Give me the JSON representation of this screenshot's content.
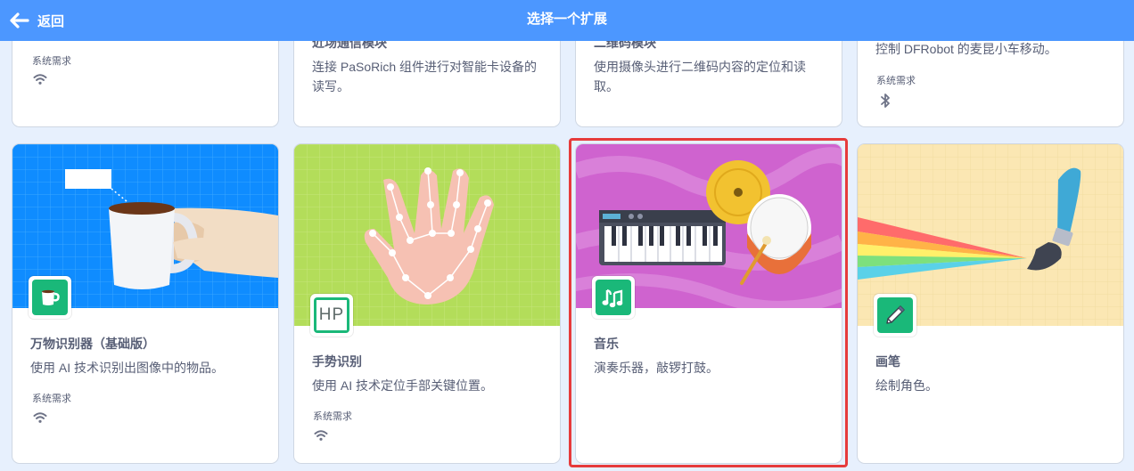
{
  "header": {
    "back_label": "返回",
    "title": "选择一个扩展"
  },
  "top_cards": [
    {
      "name": "",
      "description": "",
      "requirement_label": "系统需求",
      "requirement_icon": "wifi-icon"
    },
    {
      "name": "近场通信模块",
      "description": "连接 PaSoRich 组件进行对智能卡设备的读写。"
    },
    {
      "name": "二维码模块",
      "description": "使用摄像头进行二维码内容的定位和读取。"
    },
    {
      "name": "",
      "description": "控制 DFRobot 的麦昆小车移动。",
      "requirement_label": "系统需求",
      "requirement_icon": "bluetooth-icon"
    }
  ],
  "cards": [
    {
      "name": "万物识别器（基础版）",
      "description": "使用 AI 技术识别出图像中的物品。",
      "requirement_label": "系统需求",
      "requirement_icon": "wifi-icon",
      "icon": "coffee-cup-icon"
    },
    {
      "name": "手势识别",
      "description": "使用 AI 技术定位手部关键位置。",
      "requirement_label": "系统需求",
      "requirement_icon": "wifi-icon",
      "icon": "hp-logo-icon",
      "icon_text": "HP"
    },
    {
      "name": "音乐",
      "description": "演奏乐器，敲锣打鼓。",
      "icon": "music-notes-icon",
      "selected": true
    },
    {
      "name": "画笔",
      "description": "绘制角色。",
      "icon": "pen-icon"
    }
  ],
  "colors": {
    "header": "#4c97ff",
    "background": "#e7f0fd",
    "icon_green": "#1ab879",
    "selection": "#e63b3b",
    "card_music": "#cf63cf"
  }
}
